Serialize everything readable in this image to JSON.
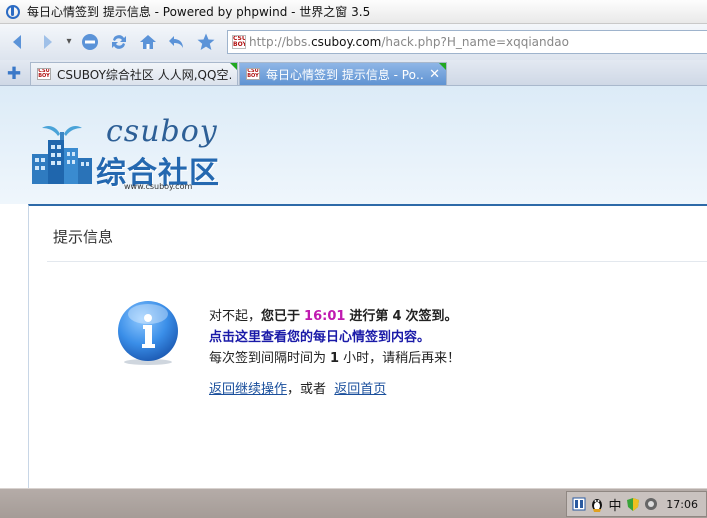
{
  "window": {
    "title": "每日心情签到 提示信息 - Powered by phpwind - 世界之窗 3.5"
  },
  "address": {
    "prefix": "http://bbs.",
    "domain": "csuboy.com",
    "path": "/hack.php?H_name=xqqiandao",
    "favicon_text": "CSU BOY"
  },
  "tabs": [
    {
      "label": "CSUBOY综合社区 人人网,QQ空…",
      "favicon_text": "CSU BOY",
      "active": false
    },
    {
      "label": "每日心情签到 提示信息 - Po…",
      "favicon_text": "CSU BOY",
      "active": true,
      "close": "✕"
    }
  ],
  "logo": {
    "english": "csuboy",
    "chinese": "综合社区",
    "url": "www.csuboy.com"
  },
  "panel": {
    "title": "提示信息",
    "line1_pre": "对不起，",
    "line1_bold": "您已于",
    "line1_time": "16:01",
    "line1_mid": "进行第",
    "line1_count": "4",
    "line1_post": "次签到。",
    "line2": "点击这里查看您的每日心情签到内容。",
    "line3_pre": "每次签到间隔时间为",
    "line3_num": "1",
    "line3_post": "小时，请稍后再来！",
    "link_back": "返回继续操作",
    "sep": "，或者",
    "link_home": "返回首页"
  },
  "taskbar": {
    "ime": "中",
    "clock": "17:06"
  },
  "colors": {
    "accent": "#2d6aa8",
    "time": "#c01ab0",
    "link": "#1a4f9c"
  }
}
